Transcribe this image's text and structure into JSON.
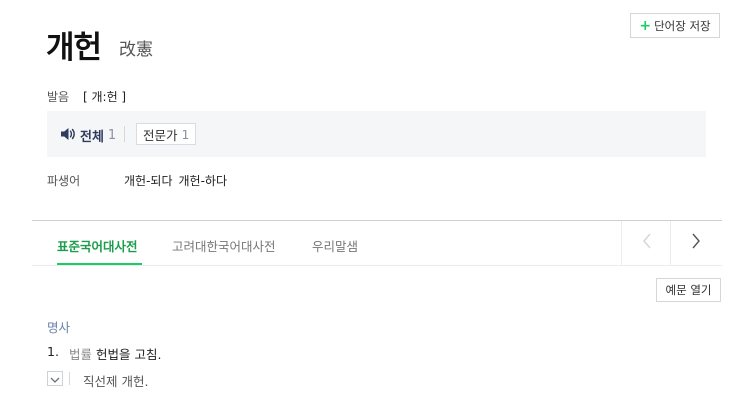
{
  "entry": {
    "headword": "개헌",
    "hanja": "改憲",
    "save_button": "단어장 저장"
  },
  "pronunciation": {
    "label": "발음",
    "value": "[ 개:헌 ]"
  },
  "audio": {
    "all_label": "전체",
    "all_count": "1",
    "expert_label": "전문가",
    "expert_count": "1"
  },
  "derivatives": {
    "label": "파생어",
    "words": [
      "개헌-되다",
      "개헌-하다"
    ]
  },
  "tabs": [
    {
      "label": "표준국어대사전",
      "active": true
    },
    {
      "label": "고려대한국어대사전",
      "active": false
    },
    {
      "label": "우리말샘",
      "active": false
    }
  ],
  "example_toggle_label": "예문 열기",
  "definition": {
    "part_of_speech": "명사",
    "number": "1.",
    "muted_prefix": "법률",
    "text": "헌법을 고침.",
    "example": "직선제 개헌."
  },
  "colors": {
    "accent_green": "#19ce60",
    "active_tab_text": "#1b9d4c",
    "pos_blue": "#6b82a8"
  },
  "icons": {
    "speaker": "speaker-icon",
    "prev": "chevron-left-icon",
    "next": "chevron-right-icon",
    "expand": "chevron-down-icon"
  }
}
